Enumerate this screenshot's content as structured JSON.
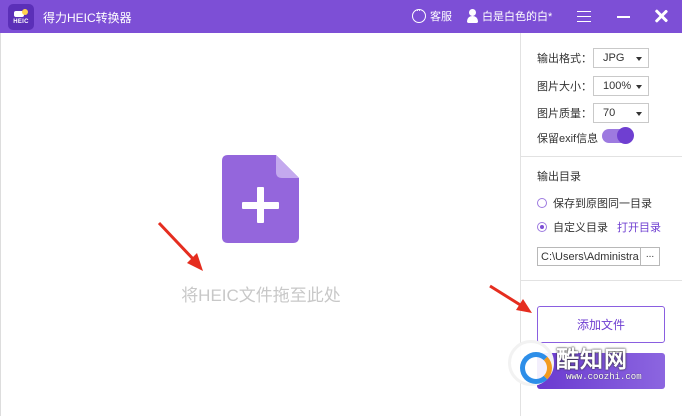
{
  "app": {
    "title": "得力HEIC转换器",
    "logo_text": "HEIC",
    "accent_color": "#7d4fd6"
  },
  "titlebar": {
    "service_label": "客服",
    "user_name": "白是白色的白*",
    "icons": [
      "chat-icon",
      "user-icon",
      "menu-icon",
      "minimize-icon",
      "close-icon"
    ]
  },
  "dropzone": {
    "hint": "将HEIC文件拖至此处"
  },
  "settings": {
    "format_label": "输出格式：",
    "format_value": "JPG",
    "size_label": "图片大小：",
    "size_value": "100%",
    "quality_label": "图片质量：",
    "quality_value": "70",
    "exif_label": "保留exif信息",
    "exif_enabled": true
  },
  "output": {
    "heading": "输出目录",
    "option_same": "保存到原图同一目录",
    "option_custom": "自定义目录",
    "selected_option": "自定义目录",
    "open_link": "打开目录",
    "path": "C:\\Users\\Administra",
    "browse_label": "..."
  },
  "actions": {
    "add_files_label": "添加文件"
  },
  "watermark": {
    "brand": "酷知网",
    "url": "www.coozhi.com"
  }
}
